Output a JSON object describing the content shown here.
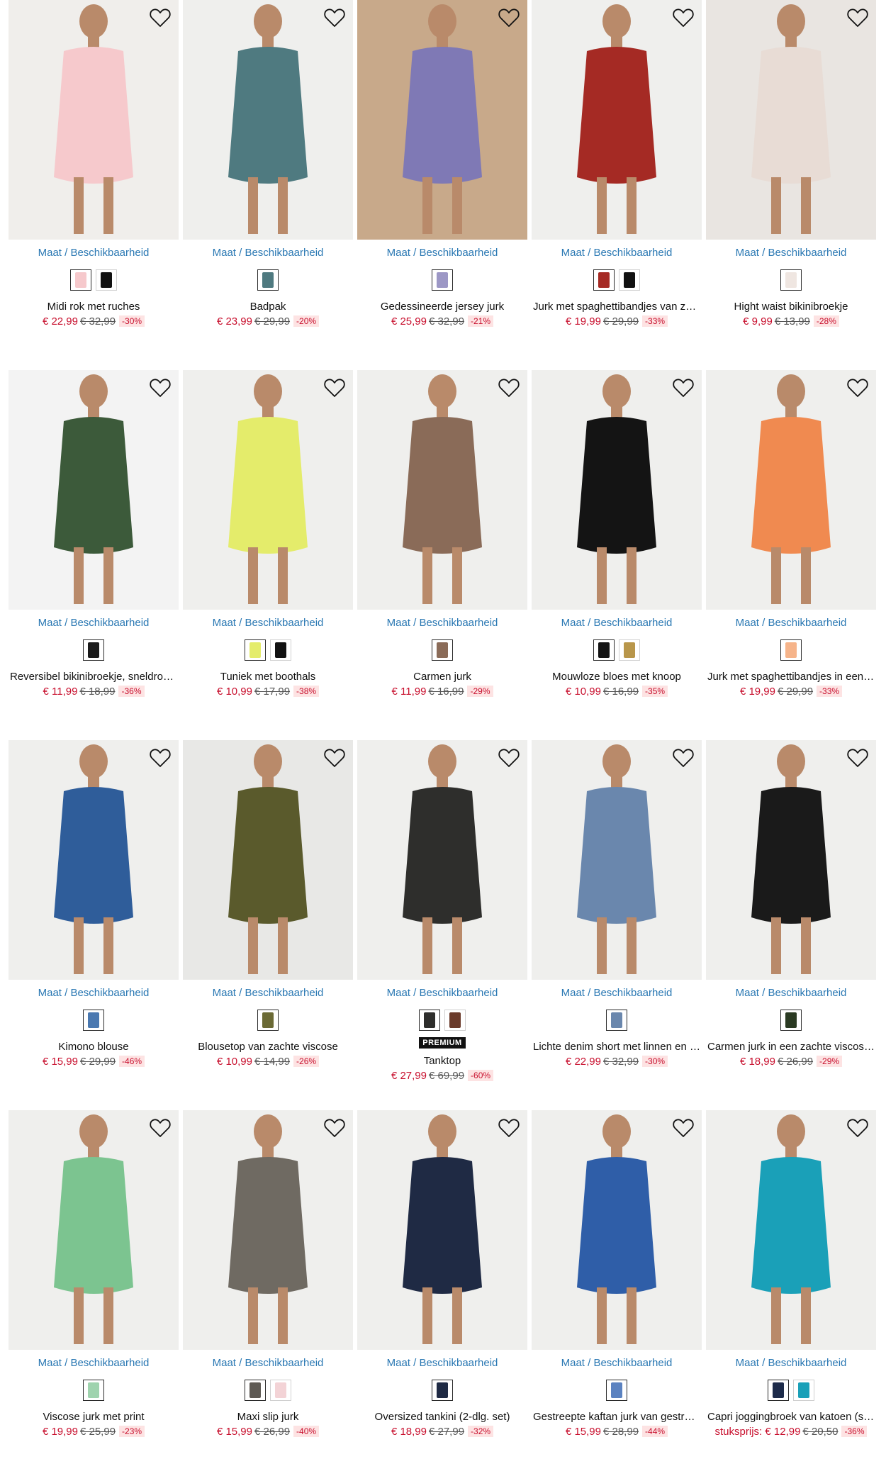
{
  "availability_label": "Maat / Beschikbaarheid",
  "premium_label": "PREMIUM",
  "products": [
    {
      "name": "Midi rok met ruches",
      "price": "€ 22,99",
      "old": "€ 32,99",
      "discount": "-30%",
      "bg": "#f0eeeb",
      "main": "#f6c9cc",
      "swatches": [
        "#f6c9cc",
        "#111111"
      ]
    },
    {
      "name": "Badpak",
      "price": "€ 23,99",
      "old": "€ 29,99",
      "discount": "-20%",
      "bg": "#efefed",
      "main": "#4f7a80",
      "swatches": [
        "#4f7a80"
      ]
    },
    {
      "name": "Gedessineerde jersey jurk",
      "price": "€ 25,99",
      "old": "€ 32,99",
      "discount": "-21%",
      "bg": "#c8a98a",
      "main": "#7f79b5",
      "swatches": [
        "#9c97c5"
      ]
    },
    {
      "name": "Jurk met spaghettibandjes van zac…",
      "price": "€ 19,99",
      "old": "€ 29,99",
      "discount": "-33%",
      "bg": "#efefed",
      "main": "#a52a24",
      "swatches": [
        "#a52a24",
        "#111111"
      ]
    },
    {
      "name": "Hight waist bikinibroekje",
      "price": "€ 9,99",
      "old": "€ 13,99",
      "discount": "-28%",
      "bg": "#e9e5e1",
      "main": "#e8dcd5",
      "swatches": [
        "#efe6e1"
      ]
    },
    {
      "name": "Reversibel bikinibroekje, sneldrog…",
      "price": "€ 11,99",
      "old": "€ 18,99",
      "discount": "-36%",
      "bg": "#f3f3f3",
      "main": "#3c5a3a",
      "swatches": [
        "#1a1a1a"
      ]
    },
    {
      "name": "Tuniek met boothals",
      "price": "€ 10,99",
      "old": "€ 17,99",
      "discount": "-38%",
      "bg": "#efefed",
      "main": "#e4ec6b",
      "swatches": [
        "#e4ec6b",
        "#111111"
      ]
    },
    {
      "name": "Carmen jurk",
      "price": "€ 11,99",
      "old": "€ 16,99",
      "discount": "-29%",
      "bg": "#efefed",
      "main": "#8a6b58",
      "swatches": [
        "#8a6b58"
      ]
    },
    {
      "name": "Mouwloze bloes met knoop",
      "price": "€ 10,99",
      "old": "€ 16,99",
      "discount": "-35%",
      "bg": "#efefed",
      "main": "#141414",
      "swatches": [
        "#141414",
        "#b8964a"
      ]
    },
    {
      "name": "Jurk met spaghettibandjes in een z…",
      "price": "€ 19,99",
      "old": "€ 29,99",
      "discount": "-33%",
      "bg": "#efefed",
      "main": "#f08a50",
      "swatches": [
        "#f6b48a"
      ]
    },
    {
      "name": "Kimono blouse",
      "price": "€ 15,99",
      "old": "€ 29,99",
      "discount": "-46%",
      "bg": "#efefed",
      "main": "#2f5d9a",
      "swatches": [
        "#4a78b0"
      ]
    },
    {
      "name": "Blousetop van zachte viscose",
      "price": "€ 10,99",
      "old": "€ 14,99",
      "discount": "-26%",
      "bg": "#e8e8e6",
      "main": "#5a5a2c",
      "swatches": [
        "#6b6a35"
      ]
    },
    {
      "name": "Tanktop",
      "price": "€ 27,99",
      "old": "€ 69,99",
      "discount": "-60%",
      "bg": "#efefed",
      "main": "#2e2e2c",
      "swatches": [
        "#2e2e2c",
        "#6a3a2a"
      ],
      "premium": true
    },
    {
      "name": "Lichte denim short met linnen en c…",
      "price": "€ 22,99",
      "old": "€ 32,99",
      "discount": "-30%",
      "bg": "#efefed",
      "main": "#6a87ad",
      "swatches": [
        "#6a87ad"
      ]
    },
    {
      "name": "Carmen jurk in een zachte viscosemix",
      "price": "€ 18,99",
      "old": "€ 26,99",
      "discount": "-29%",
      "bg": "#efefed",
      "main": "#1a1a1a",
      "swatches": [
        "#2a3a22"
      ]
    },
    {
      "name": "Viscose jurk met print",
      "price": "€ 19,99",
      "old": "€ 25,99",
      "discount": "-23%",
      "bg": "#efefed",
      "main": "#7cc490",
      "swatches": [
        "#9fd3ae"
      ]
    },
    {
      "name": "Maxi slip jurk",
      "price": "€ 15,99",
      "old": "€ 26,99",
      "discount": "-40%",
      "bg": "#efefed",
      "main": "#6f6a62",
      "swatches": [
        "#5e5a54",
        "#f3d3d6"
      ]
    },
    {
      "name": "Oversized tankini (2-dlg. set)",
      "price": "€ 18,99",
      "old": "€ 27,99",
      "discount": "-32%",
      "bg": "#efefed",
      "main": "#1f2a44",
      "swatches": [
        "#1f2a44"
      ]
    },
    {
      "name": "Gestreepte kaftan jurk van gestruc…",
      "price": "€ 15,99",
      "old": "€ 28,99",
      "discount": "-44%",
      "bg": "#efefed",
      "main": "#2f5ea8",
      "swatches": [
        "#5b82c0"
      ]
    },
    {
      "name": "Capri joggingbroek van katoen (set …",
      "prefix": "stuksprijs: ",
      "price": "€ 12,99",
      "old": "€ 20,50",
      "discount": "-36%",
      "bg": "#efefed",
      "main": "#1aa0b8",
      "swatches": [
        "#1d2b4a",
        "#1aa0b8"
      ]
    }
  ]
}
